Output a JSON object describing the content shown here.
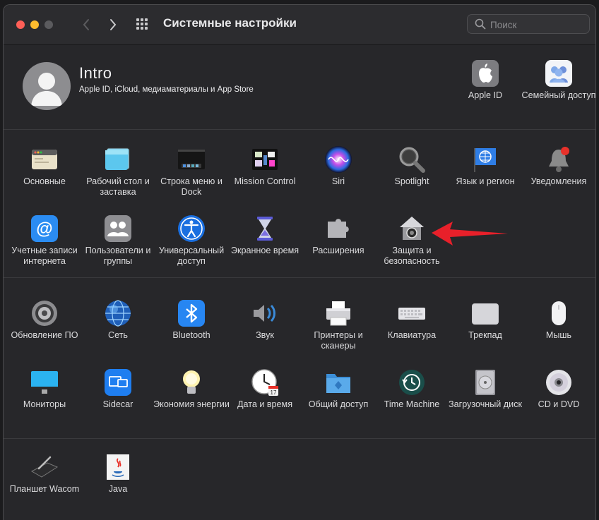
{
  "window": {
    "title": "Системные настройки",
    "controls": [
      "close",
      "minimize",
      "zoom"
    ],
    "nav": {
      "back_icon": "chevron-left-icon",
      "forward_icon": "chevron-right-icon",
      "grid_icon": "grid-icon"
    }
  },
  "search": {
    "placeholder": "Поиск",
    "value": ""
  },
  "account": {
    "name": "Intro",
    "subtitle": "Apple ID, iCloud, медиаматериалы и App Store",
    "apple_id_label": "Apple ID",
    "family_label": "Семейный доступ"
  },
  "row1": [
    {
      "label": "Основные",
      "icon": "general-icon"
    },
    {
      "label": "Рабочий стол и заставка",
      "icon": "desktop-icon"
    },
    {
      "label": "Строка меню и Dock",
      "icon": "dock-icon"
    },
    {
      "label": "Mission Control",
      "icon": "mission-control-icon"
    },
    {
      "label": "Siri",
      "icon": "siri-icon"
    },
    {
      "label": "Spotlight",
      "icon": "spotlight-icon"
    },
    {
      "label": "Язык и регион",
      "icon": "language-icon"
    },
    {
      "label": "Уведомления",
      "icon": "notifications-icon"
    }
  ],
  "row2": [
    {
      "label": "Учетные записи интернета",
      "icon": "internet-accounts-icon"
    },
    {
      "label": "Пользователи и группы",
      "icon": "users-icon"
    },
    {
      "label": "Универсальный доступ",
      "icon": "accessibility-icon"
    },
    {
      "label": "Экранное время",
      "icon": "screen-time-icon"
    },
    {
      "label": "Расширения",
      "icon": "extensions-icon"
    },
    {
      "label": "Защита и безопасность",
      "icon": "security-icon"
    }
  ],
  "row3": [
    {
      "label": "Обновление ПО",
      "icon": "software-update-icon"
    },
    {
      "label": "Сеть",
      "icon": "network-icon"
    },
    {
      "label": "Bluetooth",
      "icon": "bluetooth-icon"
    },
    {
      "label": "Звук",
      "icon": "sound-icon"
    },
    {
      "label": "Принтеры и сканеры",
      "icon": "printer-icon"
    },
    {
      "label": "Клавиатура",
      "icon": "keyboard-icon"
    },
    {
      "label": "Трекпад",
      "icon": "trackpad-icon"
    },
    {
      "label": "Мышь",
      "icon": "mouse-icon"
    }
  ],
  "row4": [
    {
      "label": "Мониторы",
      "icon": "monitor-icon"
    },
    {
      "label": "Sidecar",
      "icon": "sidecar-icon"
    },
    {
      "label": "Экономия энергии",
      "icon": "energy-saver-icon"
    },
    {
      "label": "Дата и время",
      "icon": "clock-icon"
    },
    {
      "label": "Общий доступ",
      "icon": "sharing-icon"
    },
    {
      "label": "Time Machine",
      "icon": "time-machine-icon"
    },
    {
      "label": "Загрузочный диск",
      "icon": "startup-disk-icon"
    },
    {
      "label": "CD и DVD",
      "icon": "cd-dvd-icon"
    }
  ],
  "row5": [
    {
      "label": "Планшет Wacom",
      "icon": "wacom-tablet-icon"
    },
    {
      "label": "Java",
      "icon": "java-icon"
    }
  ],
  "annotation": {
    "icon": "red-arrow-icon",
    "color": "#e8202a"
  },
  "colors": {
    "background": "#27272a",
    "titlebar": "#2c2c2f",
    "text": "#dcdcde",
    "close": "#ff5f57",
    "minimize": "#febc2e",
    "zoom": "#5b5b5e"
  }
}
